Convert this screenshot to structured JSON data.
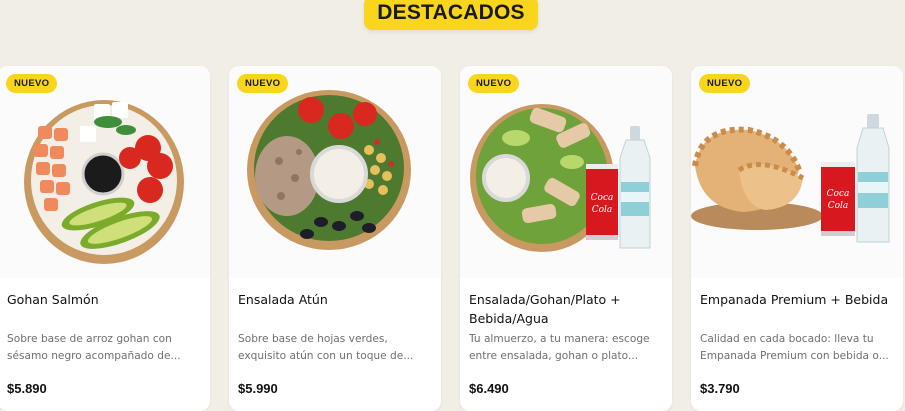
{
  "section": {
    "title": "DESTACADOS"
  },
  "products": [
    {
      "badge": "NUEVO",
      "title": "Gohan Salmón",
      "description": "Sobre base de arroz gohan con sésamo negro acompañado de...",
      "price": "$5.890"
    },
    {
      "badge": "NUEVO",
      "title": "Ensalada Atún",
      "description": "Sobre base de hojas verdes, exquisito atún con un toque de...",
      "price": "$5.990"
    },
    {
      "badge": "NUEVO",
      "title": "Ensalada/Gohan/Plato + Bebida/Agua",
      "description": "Tu almuerzo, a tu manera: escoge entre ensalada, gohan o plato...",
      "price": "$6.490"
    },
    {
      "badge": "NUEVO",
      "title": "Empanada Premium + Bebida",
      "description": "Calidad en cada bocado: lleva tu Empanada Premium con bebida o...",
      "price": "$3.790"
    }
  ],
  "colors": {
    "accent": "#f9d61b",
    "background": "#f1eee6",
    "card": "#ffffff",
    "text": "#111111",
    "muted": "#6f6f6f"
  }
}
